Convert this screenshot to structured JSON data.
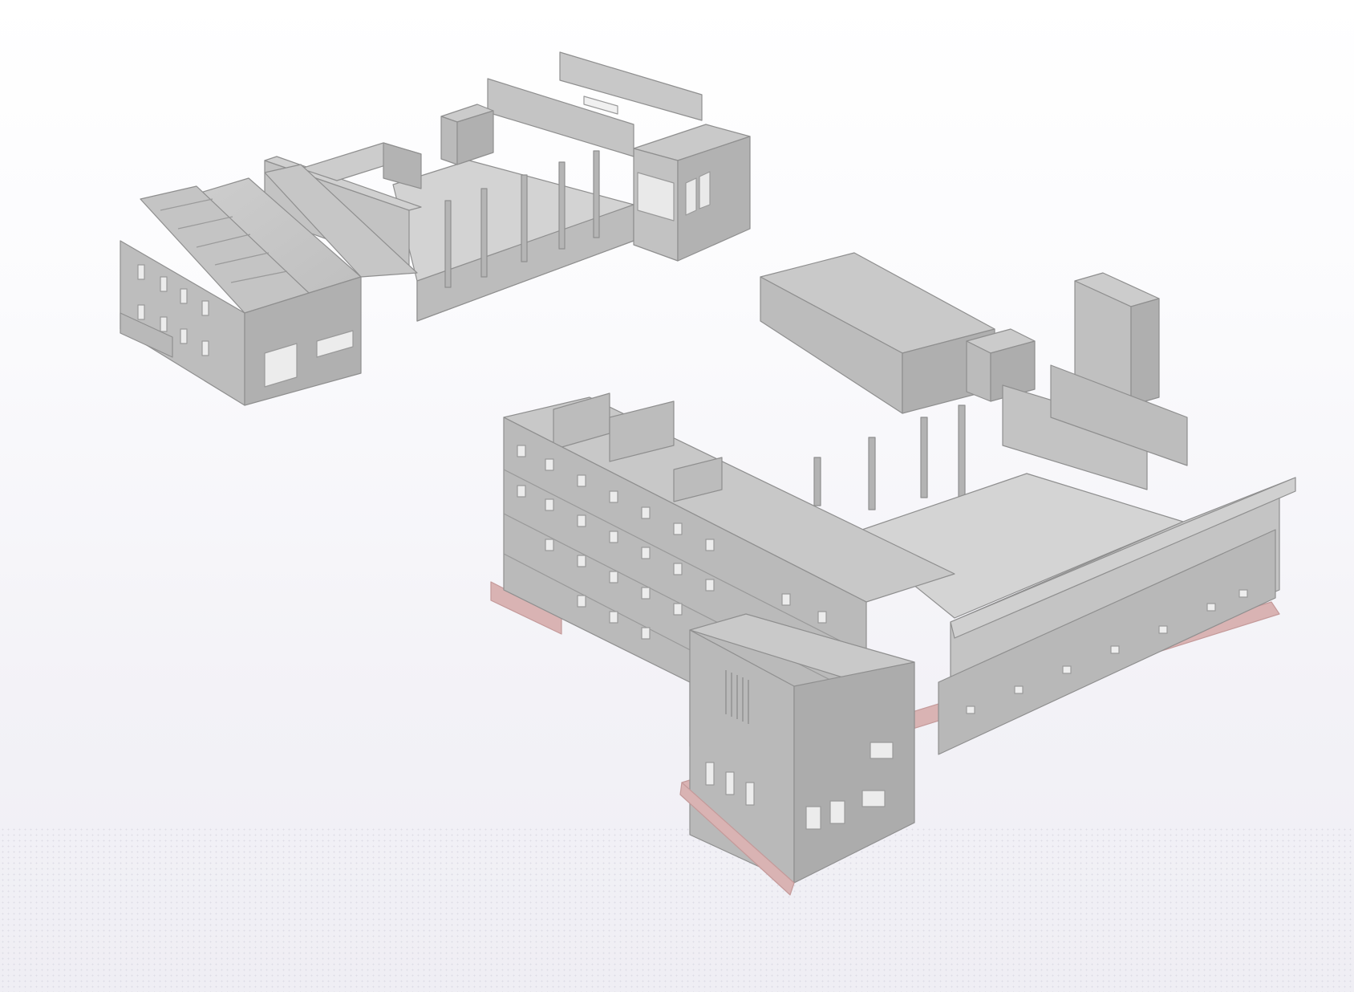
{
  "viewer": {
    "background_top": "#ffffff",
    "background_bottom": "#efeef4",
    "grid_color": "#d9d8e2"
  },
  "model": {
    "wall_light": "#cfcfcf",
    "wall_mid": "#bdbdbd",
    "wall_dark": "#a9a9a9",
    "roof": "#c7c7c7",
    "floor": "#d4d4d4",
    "edge": "#8f8f8f",
    "opening": "#f2f2f2",
    "foundation": "#d9b3b3"
  }
}
